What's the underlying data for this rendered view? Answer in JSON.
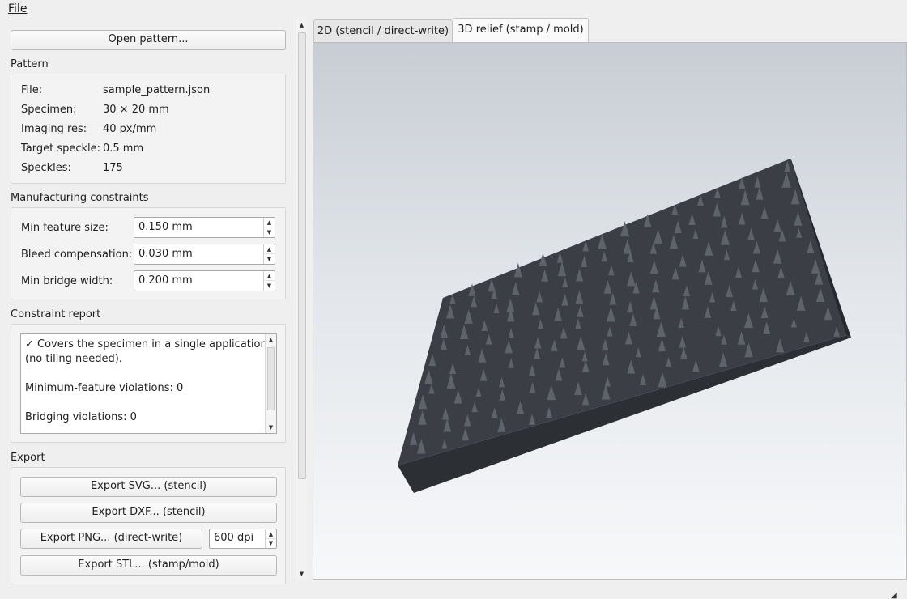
{
  "menu": {
    "file_label": "File"
  },
  "left": {
    "open_pattern_label": "Open pattern...",
    "pattern": {
      "title": "Pattern",
      "rows": [
        {
          "key": "File:",
          "value": "sample_pattern.json"
        },
        {
          "key": "Specimen:",
          "value": "30 × 20 mm"
        },
        {
          "key": "Imaging res:",
          "value": "40 px/mm"
        },
        {
          "key": "Target speckle:",
          "value": "0.5 mm"
        },
        {
          "key": "Speckles:",
          "value": "175"
        }
      ]
    },
    "constraints": {
      "title": "Manufacturing constraints",
      "rows": [
        {
          "label": "Min feature size:",
          "value": "0.150 mm"
        },
        {
          "label": "Bleed compensation:",
          "value": "0.030 mm"
        },
        {
          "label": "Min bridge width:",
          "value": "0.200 mm"
        }
      ]
    },
    "report": {
      "title": "Constraint report",
      "lines": [
        "✓ Covers the specimen in a single application",
        "(no tiling needed).",
        "Minimum-feature violations: 0",
        "Bridging violations: 0"
      ]
    },
    "export": {
      "title": "Export",
      "svg_label": "Export SVG... (stencil)",
      "dxf_label": "Export DXF... (stencil)",
      "png_label": "Export PNG... (direct-write)",
      "dpi_value": "600 dpi",
      "stl_label": "Export STL... (stamp/mold)"
    }
  },
  "tabs": [
    {
      "label": "2D (stencil / direct-write)",
      "active": false
    },
    {
      "label": "3D relief (stamp / mold)",
      "active": true
    }
  ],
  "colors": {
    "plate_top": "#3b3e44",
    "plate_side": "#2c2f33",
    "speckle": "#5e6269"
  },
  "icons": {
    "spin_up": "triangle-up-icon",
    "spin_down": "triangle-down-icon",
    "resize": "resize-grip-icon"
  }
}
